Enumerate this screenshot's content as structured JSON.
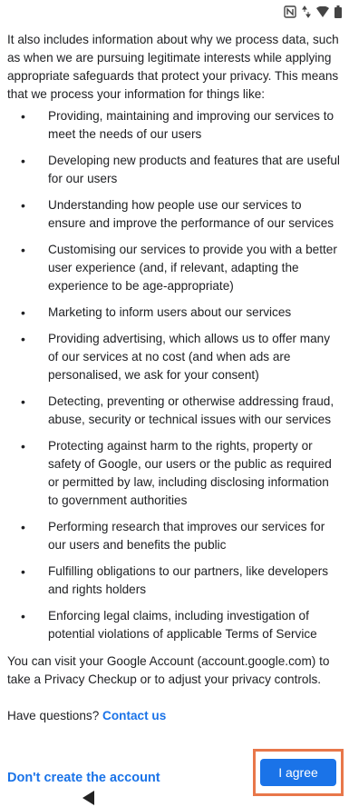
{
  "status_bar": {
    "icons": [
      "nfc-icon",
      "data-arrows-icon",
      "wifi-icon",
      "battery-icon"
    ]
  },
  "content": {
    "intro": "It also includes information about why we process data, such as when we are pursuing legitimate interests while applying appropriate safeguards that protect your privacy. This means that we process your information for things like:",
    "bullets": [
      "Providing, maintaining and improving our services to meet the needs of our users",
      "Developing new products and features that are useful for our users",
      "Understanding how people use our services to ensure and improve the performance of our services",
      "Customising our services to provide you with a better user experience (and, if relevant, adapting the experience to be age-appropriate)",
      "Marketing to inform users about our services",
      "Providing advertising, which allows us to offer many of our services at no cost (and when ads are personalised, we ask for your consent)",
      "Detecting, preventing or otherwise addressing fraud, abuse, security or technical issues with our services",
      "Protecting against harm to the rights, property or safety of Google, our users or the public as required or permitted by law, including disclosing information to government authorities",
      "Performing research that improves our services for our users and benefits the public",
      "Fulfilling obligations to our partners, like developers and rights holders",
      "Enforcing legal claims, including investigation of potential violations of applicable Terms of Service"
    ],
    "account_text": "You can visit your Google Account (account.google.com) to take a Privacy Checkup or to adjust your privacy controls.",
    "questions_text": "Have questions? ",
    "contact_link": "Contact us"
  },
  "footer": {
    "dont_create_label": "Don't create the account",
    "agree_label": "I agree"
  },
  "colors": {
    "accent": "#1a73e8",
    "highlight": "#e8774a"
  }
}
